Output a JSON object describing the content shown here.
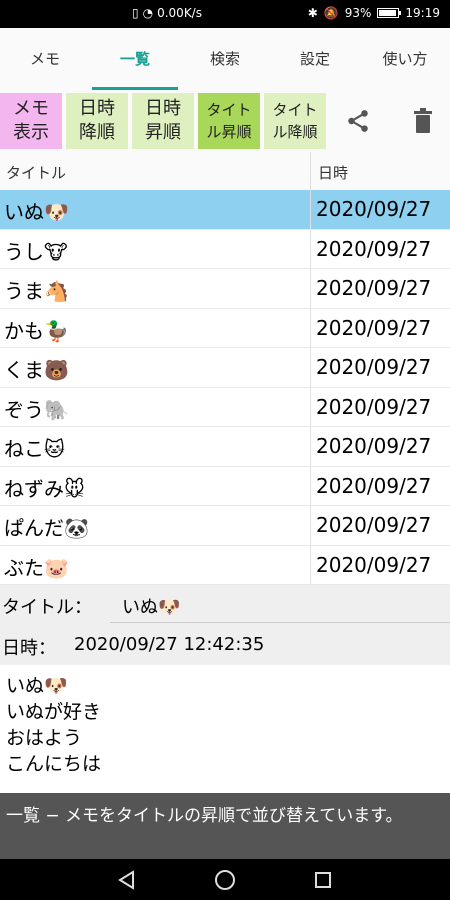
{
  "status_bar": {
    "net_speed": "0.00K/s",
    "battery": "93%",
    "battery_level": 0.93,
    "time": "19:19"
  },
  "tabs": [
    {
      "label": "メモ"
    },
    {
      "label": "一覧"
    },
    {
      "label": "検索"
    },
    {
      "label": "設定"
    },
    {
      "label": "使い方"
    }
  ],
  "toolbar": {
    "memo_display": "メモ\n表示",
    "date_desc": "日時\n降順",
    "date_asc": "日時\n昇順",
    "title_asc": "タイト\nル昇順",
    "title_desc": "タイト\nル降順"
  },
  "table": {
    "col_title": "タイトル",
    "col_date": "日時",
    "rows": [
      {
        "title": "いぬ",
        "emoji": "🐶",
        "date": "2020/09/27"
      },
      {
        "title": "うし",
        "emoji": "🐮",
        "date": "2020/09/27"
      },
      {
        "title": "うま",
        "emoji": "🐴",
        "date": "2020/09/27"
      },
      {
        "title": "かも",
        "emoji": "🦆",
        "date": "2020/09/27"
      },
      {
        "title": "くま",
        "emoji": "🐻",
        "date": "2020/09/27"
      },
      {
        "title": "ぞう",
        "emoji": "🐘",
        "date": "2020/09/27"
      },
      {
        "title": "ねこ",
        "emoji": "🐱",
        "date": "2020/09/27"
      },
      {
        "title": "ねずみ",
        "emoji": "🐭",
        "date": "2020/09/27"
      },
      {
        "title": "ぱんだ",
        "emoji": "🐼",
        "date": "2020/09/27"
      },
      {
        "title": "ぶた",
        "emoji": "🐷",
        "date": "2020/09/27"
      }
    ]
  },
  "detail": {
    "title_label": "タイトル：",
    "title_value": "いぬ🐶",
    "date_label": "日時：",
    "date_value": "2020/09/27 12:42:35",
    "body_lines": [
      "いぬ🐶",
      "いぬが好き",
      "おはよう",
      "こんにちは"
    ]
  },
  "message": "一覧 − メモをタイトルの昇順で並び替えています。",
  "colors": {
    "accent": "#1aa193",
    "selected_row": "#8dd0ef",
    "memo_btn": "#f4b6ef",
    "sort_btn": "#dff0c0",
    "sort_btn_active": "#a8d75a"
  },
  "icons": [
    "sim-icon",
    "wifi-icon",
    "bluetooth-icon",
    "mute-icon",
    "battery-icon",
    "share-icon",
    "trash-icon",
    "back-icon",
    "home-icon",
    "recent-apps-icon"
  ]
}
